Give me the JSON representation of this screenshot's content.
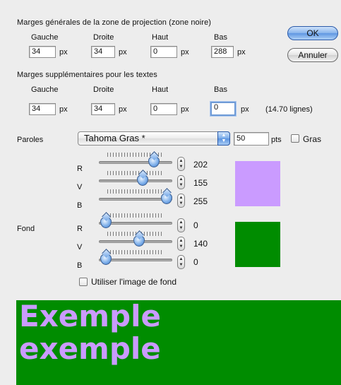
{
  "margins_general": {
    "heading": "Marges générales de la zone de projection (zone noire)",
    "labels": {
      "left": "Gauche",
      "right": "Droite",
      "top": "Haut",
      "bottom": "Bas"
    },
    "values": {
      "left": "34",
      "right": "34",
      "top": "0",
      "bottom": "288"
    },
    "unit": "px"
  },
  "margins_text": {
    "heading": "Marges supplémentaires pour les textes",
    "labels": {
      "left": "Gauche",
      "right": "Droite",
      "top": "Haut",
      "bottom": "Bas"
    },
    "values": {
      "left": "34",
      "right": "34",
      "top": "0",
      "bottom": "0"
    },
    "unit": "px",
    "lines_info": "(14.70 lignes)"
  },
  "buttons": {
    "ok": "OK",
    "cancel": "Annuler"
  },
  "lyrics": {
    "label": "Paroles",
    "font": "Tahoma Gras *",
    "size": "50",
    "size_unit": "pts",
    "bold_label": "Gras",
    "bold_checked": false,
    "channels": [
      {
        "label": "R",
        "value": "202",
        "level": 0.792
      },
      {
        "label": "V",
        "value": "155",
        "level": 0.608
      },
      {
        "label": "B",
        "value": "255",
        "level": 1.0
      }
    ],
    "color": "#ca9bff"
  },
  "background": {
    "label": "Fond",
    "channels": [
      {
        "label": "R",
        "value": "0",
        "level": 0.0
      },
      {
        "label": "V",
        "value": "140",
        "level": 0.549
      },
      {
        "label": "B",
        "value": "0",
        "level": 0.0
      }
    ],
    "color": "#008c00",
    "use_image_label": "Utiliser l'image de fond",
    "use_image_checked": false
  },
  "preview": {
    "line1": "Exemple",
    "line2": "exemple",
    "text_color": "#ca9bff",
    "bg_color": "#008c00"
  }
}
